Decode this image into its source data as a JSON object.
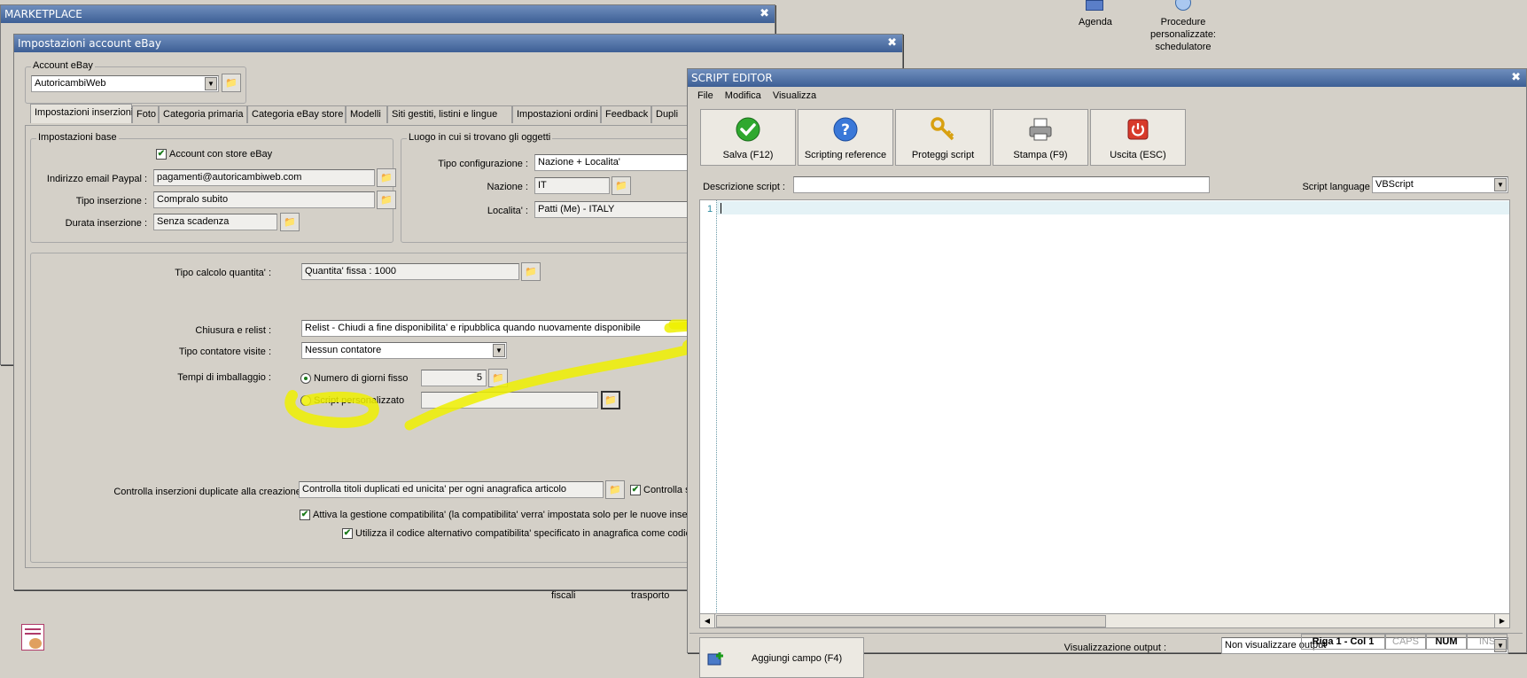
{
  "desktop": {
    "agenda_label": "Agenda",
    "procedure_label_1": "Procedure",
    "procedure_label_2": "personalizzate:",
    "procedure_label_3": "schedulatore"
  },
  "marketplace": {
    "title": "MARKETPLACE",
    "bottom_labels": [
      "fiscali",
      "trasporto"
    ]
  },
  "ebay": {
    "title": "Impostazioni account eBay",
    "account_group_label": "Account eBay",
    "account_value": "AutoricambiWeb",
    "tabs": [
      "Impostazioni inserzioni",
      "Foto",
      "Categoria primaria",
      "Categoria eBay store",
      "Modelli",
      "Siti gestiti, listini e lingue",
      "Impostazioni ordini",
      "Feedback",
      "Dupli"
    ],
    "base": {
      "group_label": "Impostazioni base",
      "store_checkbox_label": "Account con store eBay",
      "paypal_label": "Indirizzo email Paypal :",
      "paypal_value": "pagamenti@autoricambiweb.com",
      "tipo_ins_label": "Tipo inserzione :",
      "tipo_ins_value": "Compralo subito",
      "durata_label": "Durata inserzione :",
      "durata_value": "Senza scadenza"
    },
    "luogo": {
      "group_label": "Luogo in cui si trovano gli oggetti",
      "tipo_conf_label": "Tipo configurazione :",
      "tipo_conf_value": "Nazione + Localita'",
      "nazione_label": "Nazione :",
      "nazione_value": "IT",
      "localita_label": "Localita' :",
      "localita_value": "Patti (Me) - ITALY"
    },
    "lower": {
      "tipo_calcolo_label": "Tipo calcolo quantita' :",
      "tipo_calcolo_value": "Quantita' fissa : 1000",
      "chiusura_label": "Chiusura e relist :",
      "chiusura_value": "Relist - Chiudi a fine disponibilita' e ripubblica quando nuovamente disponibile",
      "contatore_label": "Tipo contatore visite :",
      "contatore_value": "Nessun contatore",
      "imballaggio_label": "Tempi di imballaggio :",
      "radio_giorni_label": "Numero di giorni fisso",
      "giorni_value": "5",
      "radio_script_label": "Script personalizzato",
      "duplicate_label": "Controlla inserzioni duplicate alla creazione :",
      "duplicate_value": "Controlla titoli duplicati ed unicita' per ogni anagrafica articolo",
      "controlla_label": "Controlla s",
      "compat_label": "Attiva la gestione compatibilita'  (la compatibilita' verra' impostata solo per le nuove inser",
      "codice_label": "Utilizza il codice alternativo compatibilita' specificato in anagrafica come codice"
    }
  },
  "script_editor": {
    "title": "SCRIPT EDITOR",
    "menu": [
      "File",
      "Modifica",
      "Visualizza"
    ],
    "toolbar": [
      {
        "label": "Salva (F12)",
        "icon": "check-icon"
      },
      {
        "label": "Scripting reference",
        "icon": "help-icon"
      },
      {
        "label": "Proteggi script",
        "icon": "key-icon"
      },
      {
        "label": "Stampa (F9)",
        "icon": "printer-icon"
      },
      {
        "label": "Uscita (ESC)",
        "icon": "power-icon"
      }
    ],
    "descrizione_label": "Descrizione script :",
    "descrizione_value": "",
    "language_label": "Script language :",
    "language_value": "VBScript",
    "line_number": "1",
    "aggiungi_label": "Aggiungi campo (F4)",
    "output_label": "Visualizzazione output :",
    "output_value": "Non visualizzare output",
    "status": {
      "position": "Riga 1 - Col 1",
      "caps": "CAPS",
      "num": "NUM",
      "ins": "INS"
    }
  },
  "colors": {
    "title_gradient_top": "#6f8ebd",
    "title_gradient_bottom": "#3d5f95",
    "highlight": "#eef000",
    "check_green": "#1a7a1a"
  }
}
